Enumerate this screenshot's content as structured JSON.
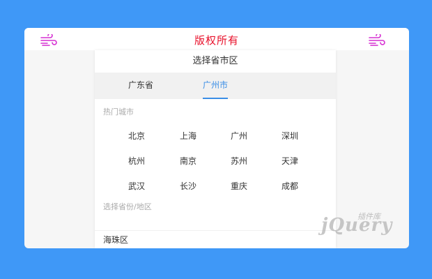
{
  "header": {
    "title": "版权所有"
  },
  "picker": {
    "heading": "选择省市区",
    "tabs": [
      {
        "label": "广东省",
        "active": false
      },
      {
        "label": "广州市",
        "active": true
      }
    ],
    "hot_label": "热门城市",
    "hot_cities": [
      "北京",
      "上海",
      "广州",
      "深圳",
      "杭州",
      "南京",
      "苏州",
      "天津",
      "武汉",
      "长沙",
      "重庆",
      "成都"
    ],
    "region_label": "选择省份/地区",
    "selected_region": "海珠区"
  },
  "watermark": {
    "text": "jQuery",
    "small": "插件库"
  },
  "colors": {
    "background": "#3f98f7",
    "title": "#e8102a",
    "accent": "#3a8ee6",
    "icon": "#d52fd2"
  },
  "icons": {
    "left": "wind-icon",
    "right": "wind-icon"
  }
}
